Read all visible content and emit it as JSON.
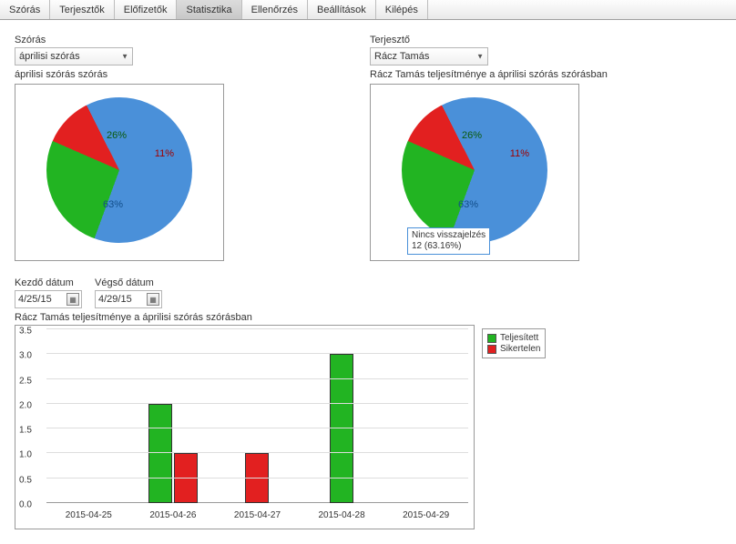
{
  "tabs": [
    "Szórás",
    "Terjesztők",
    "Előfizetők",
    "Statisztika",
    "Ellenőrzés",
    "Beállítások",
    "Kilépés"
  ],
  "active_tab_index": 3,
  "left": {
    "label": "Szórás",
    "dropdown_value": "áprilisi szórás",
    "chart_title": "áprilisi szórás szórás"
  },
  "right": {
    "label": "Terjesztő",
    "dropdown_value": "Rácz Tamás",
    "chart_title": "Rácz Tamás teljesítménye a áprilisi szórás szórásban"
  },
  "pie_labels": {
    "green": "26%",
    "red": "11%",
    "blue": "63%"
  },
  "tooltip": {
    "line1": "Nincs visszajelzés",
    "line2": "12 (63.16%)"
  },
  "dates": {
    "start_label": "Kezdő dátum",
    "end_label": "Végső dátum",
    "start_value": "4/25/15",
    "end_value": "4/29/15"
  },
  "bar_title": "Rácz Tamás teljesítménye a áprilisi szórás szórásban",
  "y_ticks": [
    "0.0",
    "0.5",
    "1.0",
    "1.5",
    "2.0",
    "2.5",
    "3.0",
    "3.5"
  ],
  "legend": {
    "green": "Teljesített",
    "red": "Sikertelen"
  },
  "chart_data": [
    {
      "type": "pie",
      "title": "áprilisi szórás szórás",
      "series": [
        {
          "name": "Teljesített",
          "value": 26,
          "color": "#22b422"
        },
        {
          "name": "Sikertelen",
          "value": 11,
          "color": "#e22020"
        },
        {
          "name": "Nincs visszajelzés",
          "value": 63,
          "color": "#4a90d9"
        }
      ]
    },
    {
      "type": "pie",
      "title": "Rácz Tamás teljesítménye a áprilisi szórás szórásban",
      "series": [
        {
          "name": "Teljesített",
          "value": 26,
          "color": "#22b422"
        },
        {
          "name": "Sikertelen",
          "value": 11,
          "color": "#e22020"
        },
        {
          "name": "Nincs visszajelzés",
          "value": 63,
          "color": "#4a90d9"
        }
      ],
      "annotations": [
        "Nincs visszajelzés",
        "12 (63.16%)"
      ]
    },
    {
      "type": "bar",
      "title": "Rácz Tamás teljesítménye a áprilisi szórás szórásban",
      "categories": [
        "2015-04-25",
        "2015-04-26",
        "2015-04-27",
        "2015-04-28",
        "2015-04-29"
      ],
      "series": [
        {
          "name": "Teljesített",
          "color": "#22b422",
          "values": [
            0,
            2,
            0,
            3,
            0
          ]
        },
        {
          "name": "Sikertelen",
          "color": "#e22020",
          "values": [
            0,
            1,
            1,
            0,
            0
          ]
        }
      ],
      "ylabel": "",
      "xlabel": "",
      "ylim": [
        0,
        3.5
      ]
    }
  ]
}
